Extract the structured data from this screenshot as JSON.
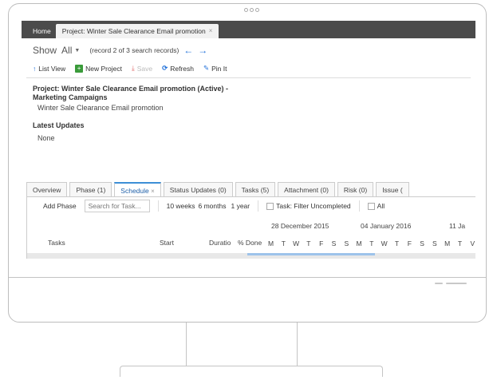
{
  "window_tabs": {
    "home": "Home",
    "project": "Project: Winter Sale Clearance Email promotion",
    "close": "×"
  },
  "showbar": {
    "label": "Show",
    "value": "All",
    "record_info": "(record 2 of 3 search records)",
    "back": "←",
    "forward": "→"
  },
  "toolbar": {
    "list_view": "List View",
    "new_project": "New Project",
    "save": "Save",
    "refresh": "Refresh",
    "pin": "Pin It"
  },
  "project": {
    "title": "Project: Winter Sale Clearance Email promotion (Active) - Marketing Campaigns",
    "subtitle": "Winter Sale Clearance Email promotion",
    "latest_updates_heading": "Latest Updates",
    "latest_updates_value": "None"
  },
  "detail_tabs": [
    "Overview",
    "Phase (1)",
    "Schedule",
    "Status Updates (0)",
    "Tasks (5)",
    "Attachment (0)",
    "Risk (0)",
    "Issue ("
  ],
  "schedule": {
    "add_phase": "Add Phase",
    "search_placeholder": "Search for Task...",
    "ranges": [
      "10 weeks",
      "6 months",
      "1 year"
    ],
    "filter_label": "Task: Filter Uncompleted",
    "all_label": "All",
    "weeks": [
      "28 December 2015",
      "04 January 2016",
      "11 Ja"
    ],
    "columns": {
      "tasks": "Tasks",
      "start": "Start",
      "duration": "Duratio",
      "done": "% Done"
    },
    "days": [
      "M",
      "T",
      "W",
      "T",
      "F",
      "S",
      "S",
      "M",
      "T",
      "W",
      "T",
      "F",
      "S",
      "S",
      "M",
      "T",
      "V"
    ]
  },
  "colors": {
    "tabbar": "#4b4b4b",
    "accent": "#1e6fd9",
    "active_tab": "#3d8fd6"
  }
}
